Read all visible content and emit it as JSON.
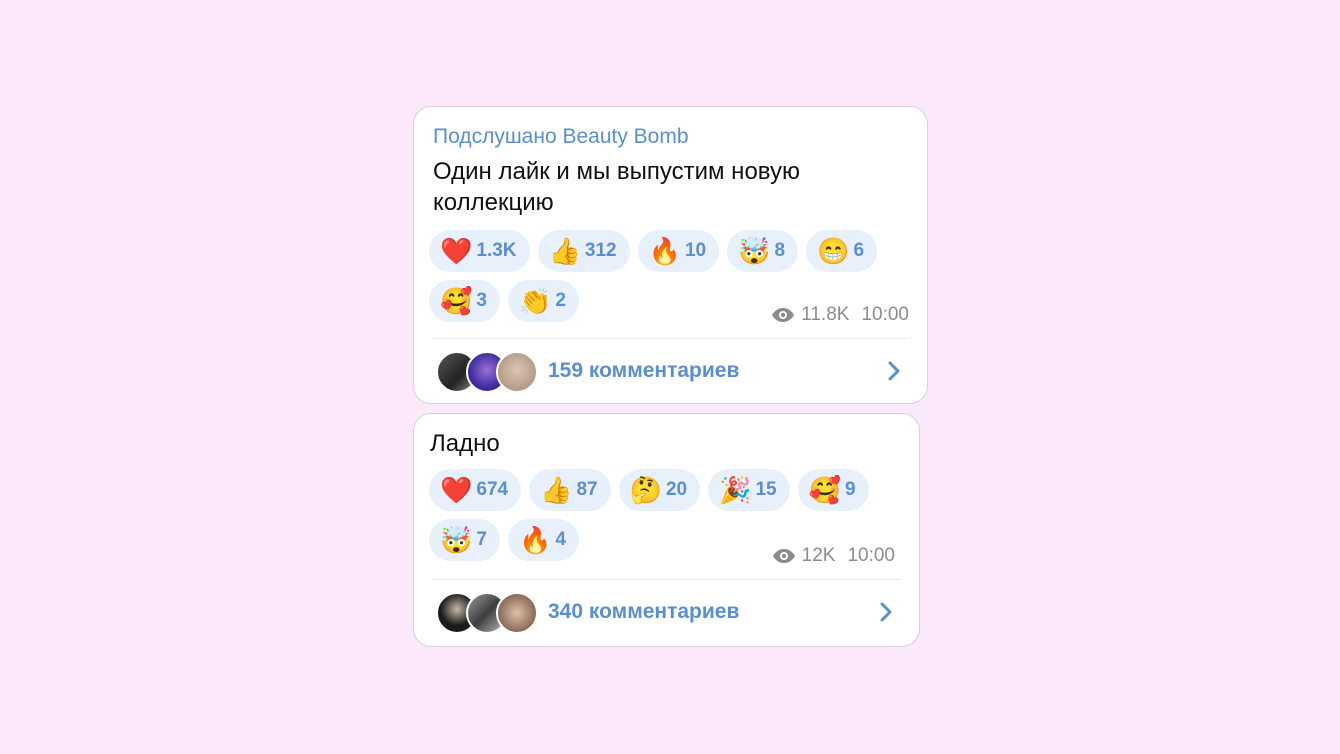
{
  "posts": [
    {
      "author": "Подслушано Beauty Bomb",
      "text": "Один лайк и мы выпустим новую коллекцию",
      "reactions": [
        {
          "emoji": "❤️",
          "count": "1.3K"
        },
        {
          "emoji": "👍",
          "count": "312"
        },
        {
          "emoji": "🔥",
          "count": "10"
        },
        {
          "emoji": "🤯",
          "count": "8"
        },
        {
          "emoji": "😁",
          "count": "6"
        },
        {
          "emoji": "🥰",
          "count": "3"
        },
        {
          "emoji": "👏",
          "count": "2"
        }
      ],
      "views": "11.8K",
      "time": "10:00",
      "comments_label": "159 комментариев"
    },
    {
      "author": "",
      "text": "Ладно",
      "reactions": [
        {
          "emoji": "❤️",
          "count": "674"
        },
        {
          "emoji": "👍",
          "count": "87"
        },
        {
          "emoji": "🤔",
          "count": "20"
        },
        {
          "emoji": "🎉",
          "count": "15"
        },
        {
          "emoji": "🥰",
          "count": "9"
        },
        {
          "emoji": "🤯",
          "count": "7"
        },
        {
          "emoji": "🔥",
          "count": "4"
        }
      ],
      "views": "12K",
      "time": "10:00",
      "comments_label": "340 комментариев"
    }
  ],
  "icons": {
    "views": "eye-icon",
    "open_comments": "chevron-right-icon",
    "commenter": "avatar"
  },
  "colors": {
    "background": "#fbe9fb",
    "accent": "#5a8fcf",
    "chip": "#e7f0fb"
  }
}
